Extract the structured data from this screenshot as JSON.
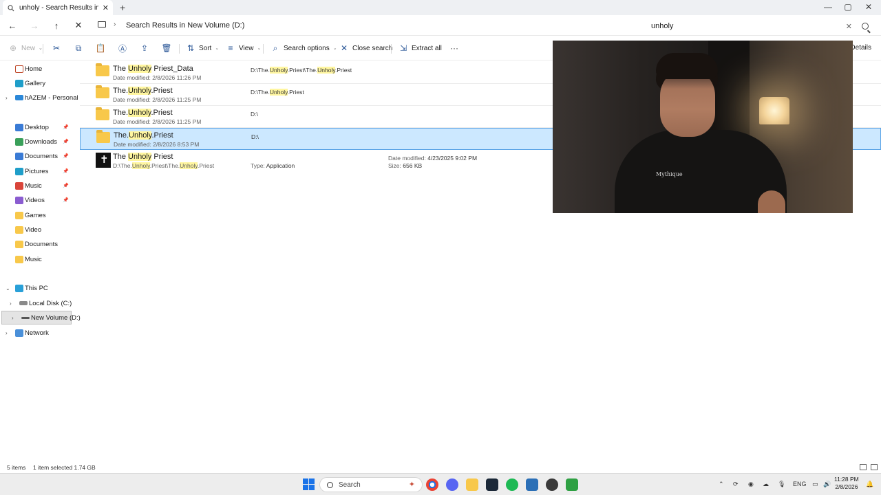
{
  "window": {
    "tab_title": "unholy - Search Results in New Volume (D:)",
    "new_tab_glyph": "+",
    "tab_close_glyph": "✕",
    "minimize_glyph": "—",
    "maximize_glyph": "▢",
    "close_glyph": "✕"
  },
  "address": {
    "back_glyph": "←",
    "forward_glyph": "→",
    "up_glyph": "↑",
    "stop_glyph": "✕",
    "crumb_chevron": "›",
    "breadcrumb": "Search Results in New Volume (D:)",
    "search_value": "unholy",
    "search_clear_glyph": "✕"
  },
  "commandbar": {
    "new_label": "New",
    "sort_label": "Sort",
    "view_label": "View",
    "search_options_label": "Search options",
    "close_search_label": "Close search",
    "extract_all_label": "Extract all",
    "more_glyph": "···",
    "details_label": "Details",
    "new_icon": "⊕",
    "cut_icon": "✂",
    "copy_icon": "⧉",
    "paste_icon": "📋",
    "rename_icon": "Ⓐ",
    "share_icon": "⇪",
    "delete_icon": "🗑",
    "sort_icon": "⇅",
    "view_icon": "≡",
    "search_options_icon": "⌕",
    "close_search_icon": "✕",
    "extract_icon": "⇲",
    "caret": "⌄"
  },
  "sidebar": {
    "expand_glyph": "›",
    "collapse_glyph": "⌄",
    "pin_glyph": "📌",
    "items": [
      {
        "label": "Home"
      },
      {
        "label": "Gallery"
      },
      {
        "label": "hAZEM - Personal"
      },
      {
        "label": "Desktop"
      },
      {
        "label": "Downloads"
      },
      {
        "label": "Documents"
      },
      {
        "label": "Pictures"
      },
      {
        "label": "Music"
      },
      {
        "label": "Videos"
      },
      {
        "label": "Games"
      },
      {
        "label": "Video"
      },
      {
        "label": "Documents"
      },
      {
        "label": "Music"
      },
      {
        "label": "This PC"
      },
      {
        "label": "Local Disk (C:)"
      },
      {
        "label": "New Volume (D:)"
      },
      {
        "label": "Network"
      }
    ]
  },
  "results": [
    {
      "name_pre": "The ",
      "name_hl": "Unholy",
      "name_post": " Priest_Data",
      "date_label": "Date modified:",
      "date": "2/8/2026 11:26 PM",
      "path_a": "D:\\The.",
      "path_hl1": "Unholy",
      "path_b": ".Priest\\The.",
      "path_hl2": "Unholy",
      "path_c": ".Priest"
    },
    {
      "name_pre": "The.",
      "name_hl": "Unholy",
      "name_post": ".Priest",
      "date_label": "Date modified:",
      "date": "2/8/2026 11:25 PM",
      "path_a": "D:\\The.",
      "path_hl1": "Unholy",
      "path_b": ".Priest"
    },
    {
      "name_pre": "The.",
      "name_hl": "Unholy",
      "name_post": ".Priest",
      "date_label": "Date modified:",
      "date": "2/8/2026 11:25 PM",
      "path_a": "D:\\"
    },
    {
      "name_pre": "The.",
      "name_hl": "Unholy",
      "name_post": ".Priest",
      "date_label": "Date modified:",
      "date": "2/8/2026 8:53 PM",
      "path_a": "D:\\"
    },
    {
      "name_pre": "The ",
      "name_hl": "Unholy",
      "name_post": " Priest",
      "sub_a": "D:\\The.",
      "sub_hl1": "Unholy",
      "sub_b": ".Priest\\The.",
      "sub_hl2": "Unholy",
      "sub_c": ".Priest",
      "type_label": "Type:",
      "type": "Application",
      "date_label": "Date modified:",
      "date": "4/23/2025 9:02 PM",
      "size_label": "Size:",
      "size": "656 KB"
    }
  ],
  "statusbar": {
    "count": "5 items",
    "selection": "1 item selected  1.74 GB"
  },
  "webcam": {
    "hoodie_text": "Mythique"
  },
  "taskbar": {
    "search_label": "Search",
    "language": "ENG",
    "time": "11:28 PM",
    "date": "2/8/2026"
  },
  "colors": {
    "selection": "#cce8ff",
    "highlight": "#fff6a0",
    "folder": "#f8c84a",
    "accent": "#1a73e8"
  }
}
